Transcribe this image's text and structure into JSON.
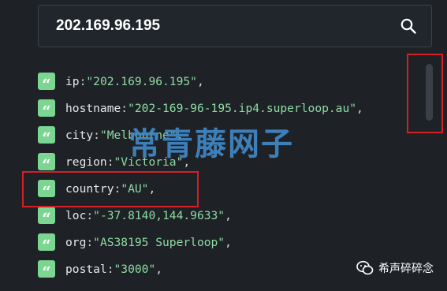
{
  "search": {
    "value": "202.169.96.195",
    "button_icon": "search-icon"
  },
  "results": [
    {
      "key": "ip",
      "value": "\"202.169.96.195\"",
      "trail": ","
    },
    {
      "key": "hostname",
      "value": "\"202-169-96-195.ip4.superloop.au\"",
      "trail": ","
    },
    {
      "key": "city",
      "value": "\"Melbourne\"",
      "trail": ","
    },
    {
      "key": "region",
      "value": "\"Victoria\"",
      "trail": ","
    },
    {
      "key": "country",
      "value": "\"AU\"",
      "trail": ","
    },
    {
      "key": "loc",
      "value": "\"-37.8140,144.9633\"",
      "trail": ","
    },
    {
      "key": "org",
      "value": "\"AS38195 Superloop\"",
      "trail": ","
    },
    {
      "key": "postal",
      "value": "\"3000\"",
      "trail": ","
    }
  ],
  "row_icon": "quote-icon",
  "row_icon_glyph": "“",
  "colon": ":",
  "watermark": {
    "text": "常青藤网子",
    "account": "希声碎碎念",
    "account_icon": "wechat-icon"
  },
  "colors": {
    "background": "#1e2227",
    "badge": "#7bd691",
    "string_value": "#8fdba3",
    "highlight": "#d51f26",
    "watermark": "#4286c4"
  }
}
